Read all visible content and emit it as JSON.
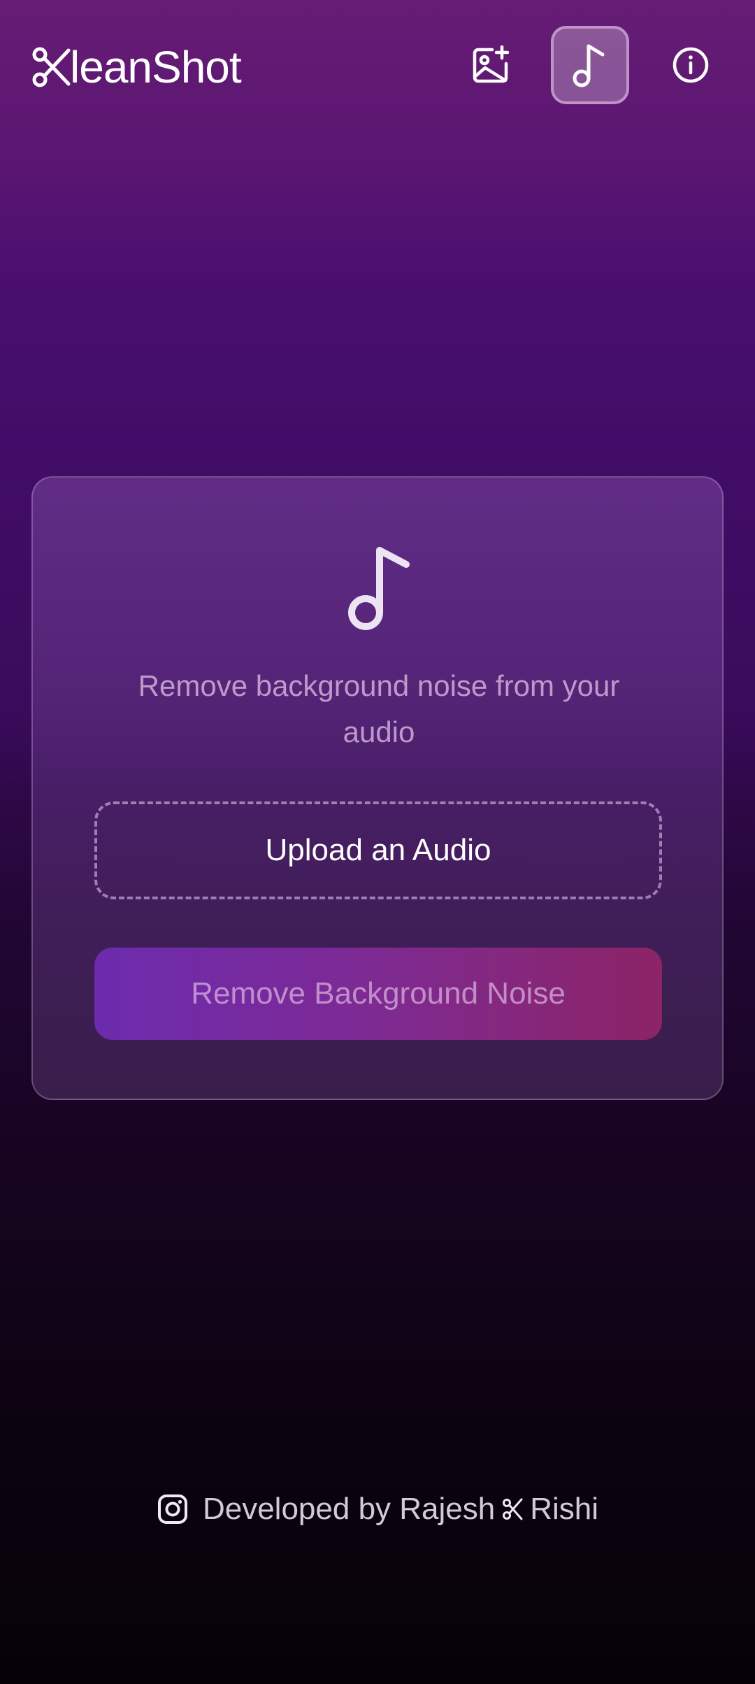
{
  "app": {
    "logo_icon": "scissors-icon",
    "logo_text": "leanShot"
  },
  "nav": {
    "items": [
      {
        "name": "image-add-icon",
        "active": false
      },
      {
        "name": "music-note-icon",
        "active": true
      },
      {
        "name": "info-icon",
        "active": false
      }
    ]
  },
  "card": {
    "icon": "music-note-icon",
    "description": "Remove background noise from your audio",
    "upload_label": "Upload an Audio",
    "action_label": "Remove Background Noise"
  },
  "footer": {
    "icon": "instagram-icon",
    "prefix": "Developed by Rajesh",
    "separator_icon": "scissors-icon",
    "suffix": "Rishi"
  },
  "colors": {
    "background_top": "#661c74",
    "background_bottom": "#060107",
    "button_gradient_start": "#6c2bae",
    "button_gradient_end": "#8c2466"
  }
}
